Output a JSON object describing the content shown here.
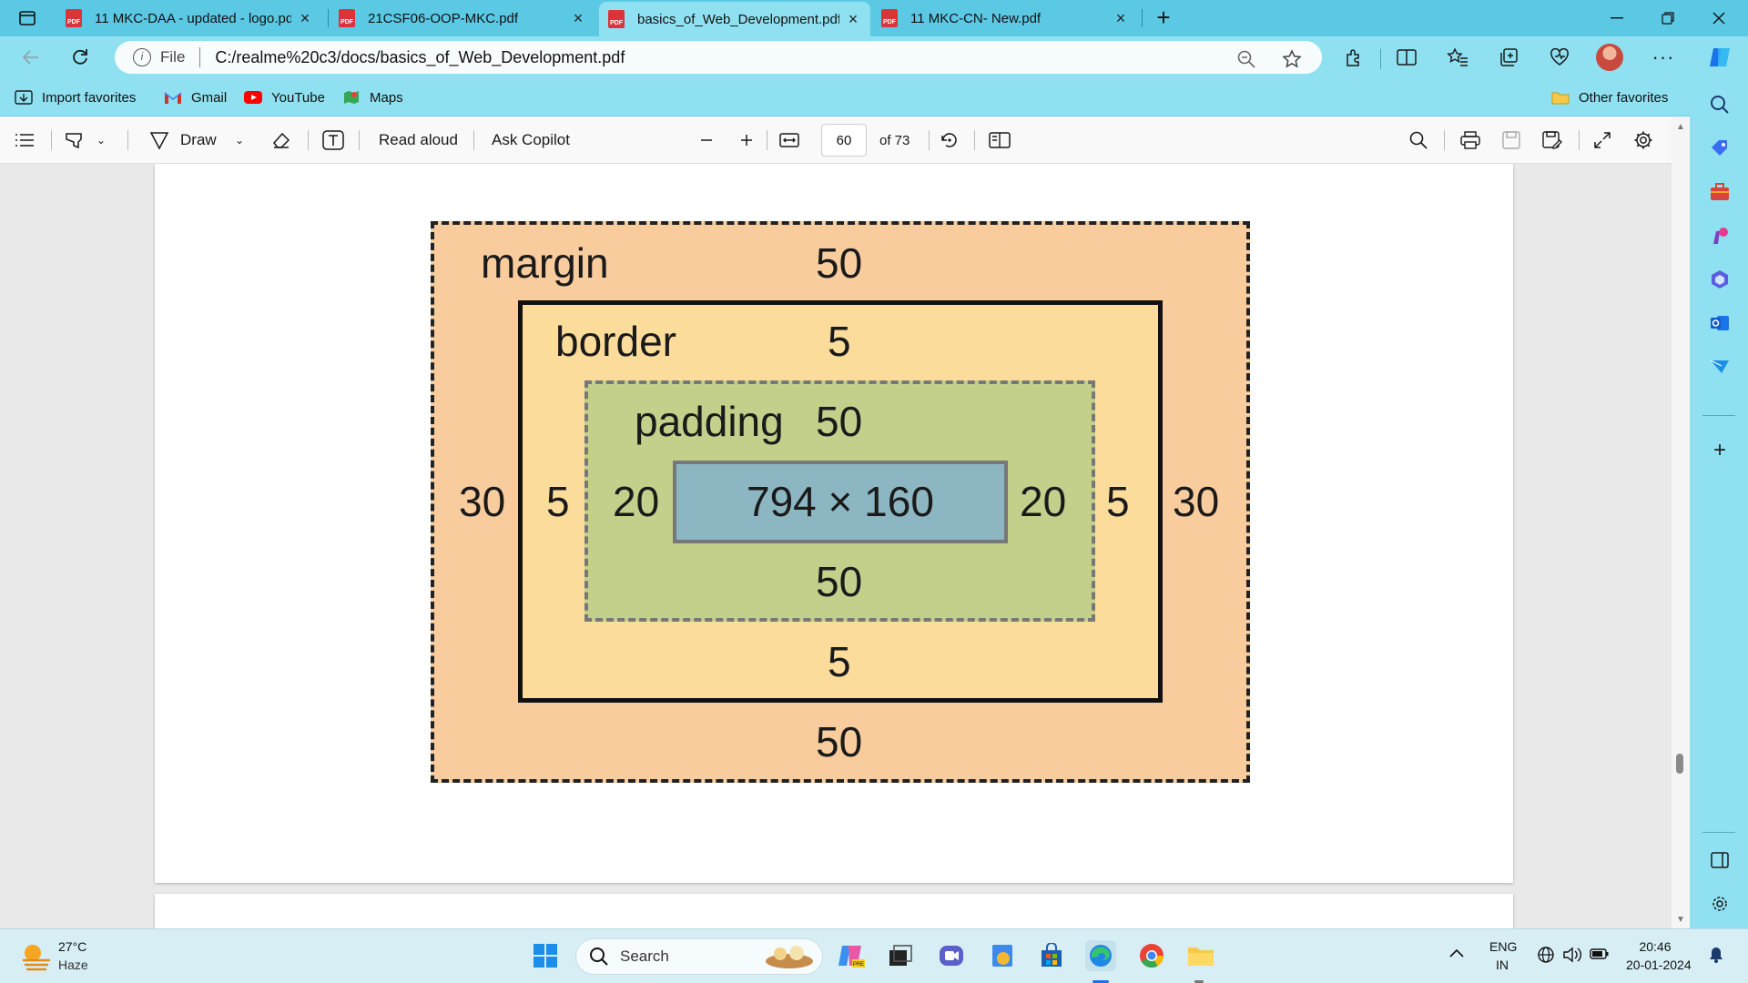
{
  "browser": {
    "tabs": [
      {
        "title": "11 MKC-DAA - updated - logo.pdf",
        "active": false
      },
      {
        "title": "21CSF06-OOP-MKC.pdf",
        "active": false
      },
      {
        "title": "basics_of_Web_Development.pdf",
        "active": true
      },
      {
        "title": "11 MKC-CN- New.pdf",
        "active": false
      }
    ],
    "file_label": "File",
    "url": "C:/realme%20c3/docs/basics_of_Web_Development.pdf"
  },
  "favorites": {
    "import": "Import favorites",
    "gmail": "Gmail",
    "youtube": "YouTube",
    "maps": "Maps",
    "other": "Other favorites"
  },
  "pdf_toolbar": {
    "draw": "Draw",
    "read_aloud": "Read aloud",
    "ask_copilot": "Ask Copilot",
    "page": "60",
    "page_total": "of 73"
  },
  "diagram": {
    "margin_label": "margin",
    "margin_top": "50",
    "margin_bottom": "50",
    "margin_left": "30",
    "margin_right": "30",
    "border_label": "border",
    "border_top": "5",
    "border_bottom": "5",
    "border_left": "5",
    "border_right": "5",
    "padding_label": "padding",
    "padding_top": "50",
    "padding_bottom": "50",
    "padding_left": "20",
    "padding_right": "20",
    "content_size": "794 × 160",
    "colors": {
      "margin": "#f8cc9d",
      "border": "#fbdc9b",
      "padding": "#c3d08c",
      "content": "#8cb6c1"
    }
  },
  "taskbar": {
    "weather_temp": "27°C",
    "weather_desc": "Haze",
    "search": "Search",
    "lang1": "ENG",
    "lang2": "IN",
    "time": "20:46",
    "date": "20-01-2024"
  }
}
